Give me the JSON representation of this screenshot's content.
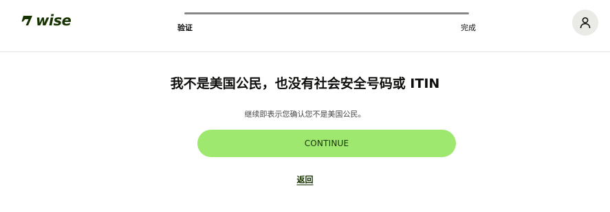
{
  "brand": {
    "name": "wise",
    "color": "#163300",
    "logo_icon": "wise-flag-icon"
  },
  "progress": {
    "start_label": "验证",
    "end_label": "完成",
    "value_percent": 100,
    "fill_color": "#868685"
  },
  "user_menu": {
    "icon": "user-icon"
  },
  "content": {
    "title": "我不是美国公民，也没有社会安全号码或 ITIN",
    "subtitle": "继续即表示您确认您不是美国公民。",
    "continue_label": "CONTINUE",
    "back_label": "返回",
    "accent_color": "#9fe870"
  }
}
